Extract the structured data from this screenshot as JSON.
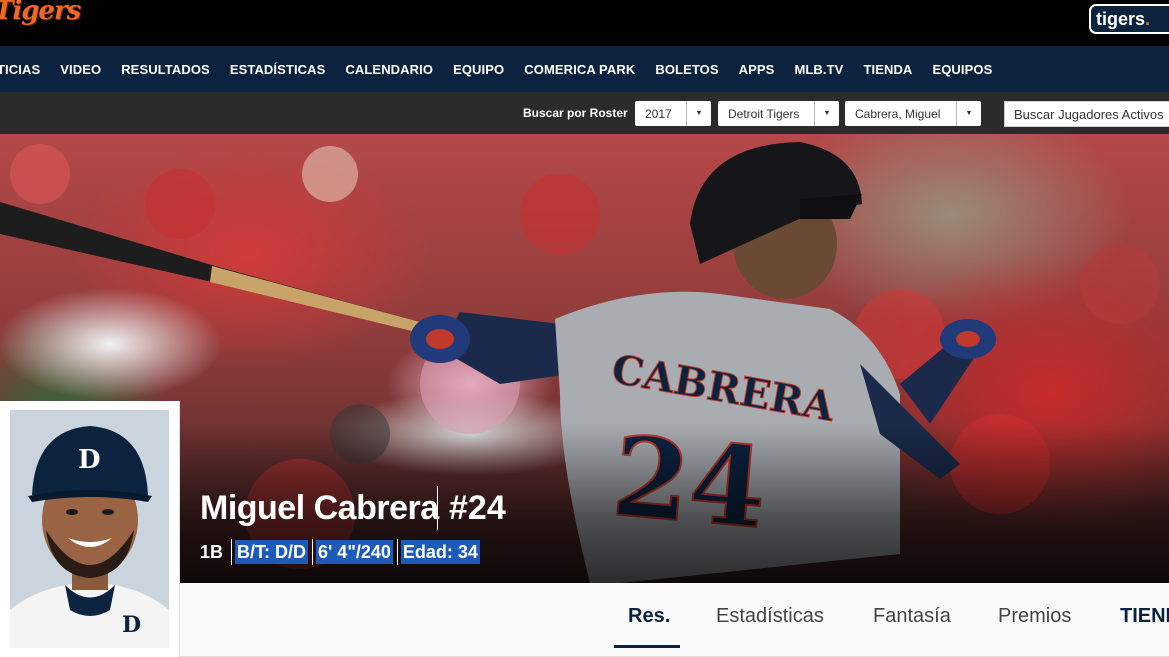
{
  "header": {
    "logo_text": "Tigers",
    "site_badge": {
      "prefix": "tigers",
      "suffix": "."
    }
  },
  "nav": {
    "items": [
      "TICIAS",
      "VIDEO",
      "RESULTADOS",
      "ESTADÍSTICAS",
      "CALENDARIO",
      "EQUIPO",
      "COMERICA PARK",
      "BOLETOS",
      "APPS",
      "MLB.TV",
      "TIENDA",
      "EQUIPOS"
    ]
  },
  "roster_search": {
    "label": "Buscar por Roster",
    "year": "2017",
    "team": "Detroit Tigers",
    "player": "Cabrera, Miguel",
    "player_search": "Buscar Jugadores Activos"
  },
  "player": {
    "name": "Miguel Cabrera",
    "number": "#24",
    "position": "1B",
    "bats_throws": "B/T: D/D",
    "height_weight": "6' 4\"/240",
    "age": "Edad: 34",
    "jersey_name": "CABRERA",
    "jersey_number": "24"
  },
  "tabs": {
    "items": [
      "Res.",
      "Estadísticas",
      "Fantasía",
      "Premios",
      "TIENDA"
    ],
    "active": "Res."
  },
  "colors": {
    "navy": "#0c2340",
    "orange": "#f26722",
    "highlight": "#1e5bb8"
  }
}
